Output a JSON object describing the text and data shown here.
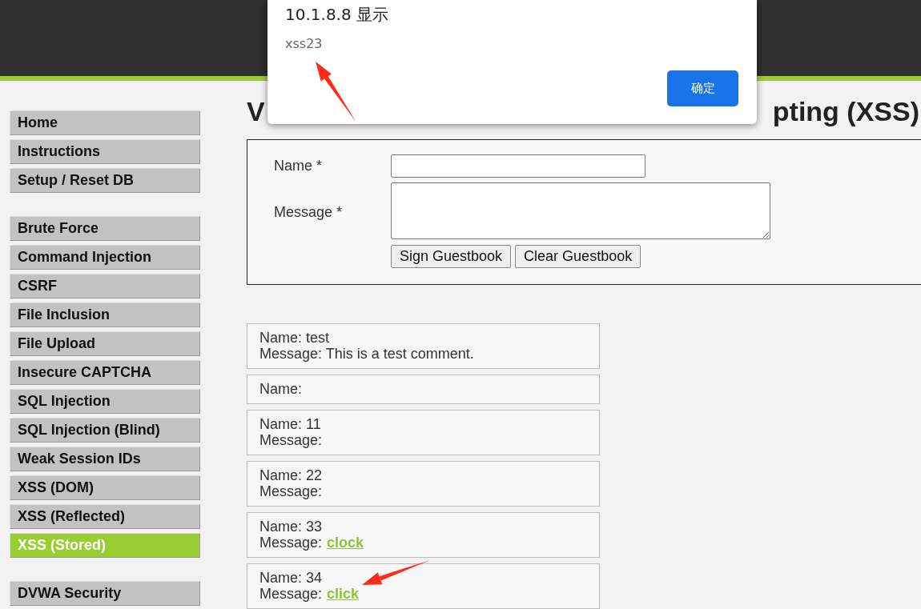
{
  "dialog": {
    "title": "10.1.8.8 显示",
    "message": "xss23",
    "ok_button": "确定"
  },
  "sidebar": {
    "groups": [
      [
        {
          "label": "Home",
          "selected": false
        },
        {
          "label": "Instructions",
          "selected": false
        },
        {
          "label": "Setup / Reset DB",
          "selected": false
        }
      ],
      [
        {
          "label": "Brute Force",
          "selected": false
        },
        {
          "label": "Command Injection",
          "selected": false
        },
        {
          "label": "CSRF",
          "selected": false
        },
        {
          "label": "File Inclusion",
          "selected": false
        },
        {
          "label": "File Upload",
          "selected": false
        },
        {
          "label": "Insecure CAPTCHA",
          "selected": false
        },
        {
          "label": "SQL Injection",
          "selected": false
        },
        {
          "label": "SQL Injection (Blind)",
          "selected": false
        },
        {
          "label": "Weak Session IDs",
          "selected": false
        },
        {
          "label": "XSS (DOM)",
          "selected": false
        },
        {
          "label": "XSS (Reflected)",
          "selected": false
        },
        {
          "label": "XSS (Stored)",
          "selected": true
        }
      ],
      [
        {
          "label": "DVWA Security",
          "selected": false
        }
      ]
    ]
  },
  "page_title": {
    "visible_start": "V",
    "visible_end": "pting (XSS)"
  },
  "form": {
    "name_label": "Name *",
    "message_label": "Message *",
    "buttons": [
      "Sign Guestbook",
      "Clear Guestbook"
    ]
  },
  "entries": [
    {
      "name": "Name: test",
      "message": "Message: This is a test comment."
    },
    {
      "name": "Name:"
    },
    {
      "name": "Name: 11",
      "message": "Message:"
    },
    {
      "name": "Name: 22",
      "message": "Message:"
    },
    {
      "name": "Name: 33",
      "message": "Message:",
      "link": "clock"
    },
    {
      "name": "Name: 34",
      "message": "Message:",
      "link": "click"
    }
  ]
}
